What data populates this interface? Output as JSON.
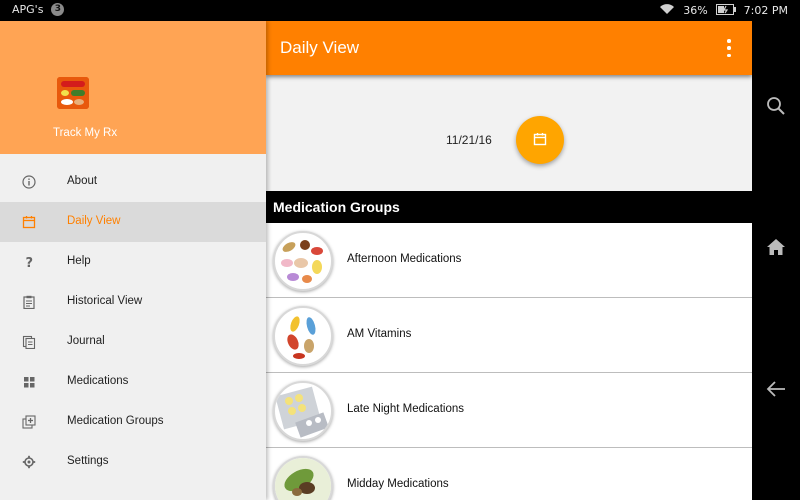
{
  "status_bar": {
    "carrier": "APG's",
    "notification_count": "3",
    "battery": "36%",
    "time": "7:02 PM"
  },
  "drawer": {
    "app_name": "Track My Rx",
    "items": [
      {
        "label": "About",
        "icon": "info-icon"
      },
      {
        "label": "Daily View",
        "icon": "calendar-icon",
        "active": true
      },
      {
        "label": "Help",
        "icon": "question-icon"
      },
      {
        "label": "Historical View",
        "icon": "clipboard-icon"
      },
      {
        "label": "Journal",
        "icon": "journal-icon"
      },
      {
        "label": "Medications",
        "icon": "grid-icon"
      },
      {
        "label": "Medication Groups",
        "icon": "add-group-icon"
      },
      {
        "label": "Settings",
        "icon": "gear-icon"
      }
    ]
  },
  "appbar": {
    "title": "Daily View"
  },
  "date": {
    "value": "11/21/16"
  },
  "groups": {
    "header": "Medication Groups",
    "items": [
      {
        "label": "Afternoon Medications"
      },
      {
        "label": "AM Vitamins"
      },
      {
        "label": "Late Night Medications"
      },
      {
        "label": "Midday Medications"
      }
    ]
  },
  "colors": {
    "primary": "#ff8000",
    "drawer_header": "#ffa454",
    "fab": "#ffa500"
  }
}
